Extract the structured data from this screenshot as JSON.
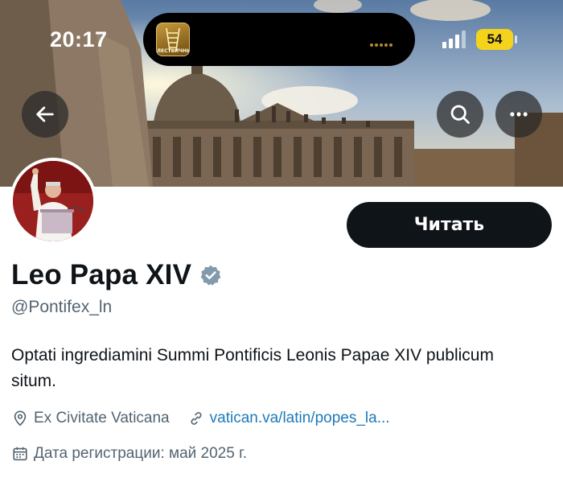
{
  "status_bar": {
    "time": "20:17",
    "battery": "54",
    "island_app_label": "ЛЕСТВИЧНИК"
  },
  "header": {
    "back_icon": "arrow-left-icon",
    "search_icon": "search-icon",
    "more_icon": "more-horizontal-icon"
  },
  "profile": {
    "display_name": "Leo Papa XIV",
    "verified": true,
    "handle": "@Pontifex_ln",
    "bio": "Optati ingrediamini Summi Pontificis Leonis Papae XIV publicum situm.",
    "location": "Ex Civitate Vaticana",
    "website": "vatican.va/latin/popes_la...",
    "joined": "Дата регистрации: май 2025 г."
  },
  "actions": {
    "follow_label": "Читать"
  },
  "colors": {
    "primary_text": "#0f1419",
    "secondary_text": "#536471",
    "link": "#1d7ab8",
    "verified_badge": "#829aab",
    "battery": "#f5d21c"
  }
}
